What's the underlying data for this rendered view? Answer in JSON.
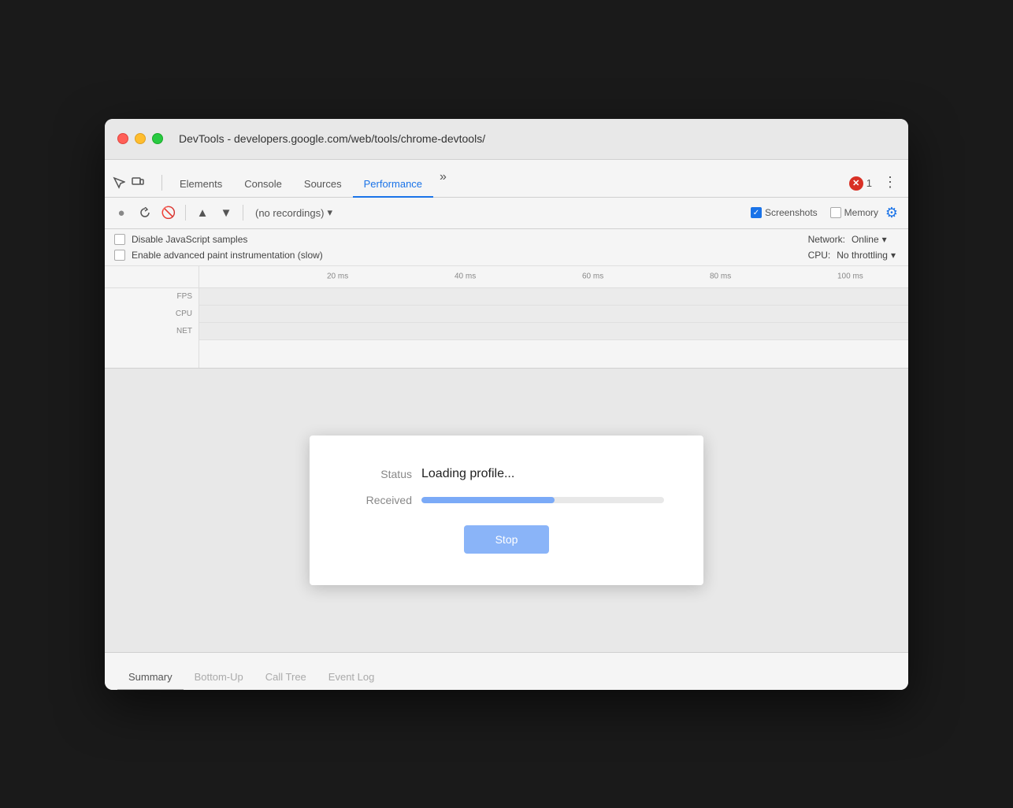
{
  "window": {
    "title": "DevTools - developers.google.com/web/tools/chrome-devtools/"
  },
  "tabs": [
    {
      "id": "elements",
      "label": "Elements",
      "active": false
    },
    {
      "id": "console",
      "label": "Console",
      "active": false
    },
    {
      "id": "sources",
      "label": "Sources",
      "active": false
    },
    {
      "id": "performance",
      "label": "Performance",
      "active": true
    }
  ],
  "toolbar": {
    "recording_label": "(no recordings)",
    "screenshots_label": "Screenshots",
    "memory_label": "Memory",
    "error_count": "1"
  },
  "settings": {
    "disable_js_samples_label": "Disable JavaScript samples",
    "enable_paint_label": "Enable advanced paint instrumentation (slow)",
    "network_label": "Network:",
    "network_value": "Online",
    "cpu_label": "CPU:",
    "cpu_value": "No throttling"
  },
  "timeline": {
    "ticks": [
      "20 ms",
      "40 ms",
      "60 ms",
      "80 ms",
      "100 ms"
    ],
    "tracks": [
      {
        "label": "FPS"
      },
      {
        "label": "CPU"
      },
      {
        "label": "NET"
      }
    ]
  },
  "dialog": {
    "status_label": "Status",
    "status_value": "Loading profile...",
    "received_label": "Received",
    "progress_percent": 55,
    "stop_button_label": "Stop"
  },
  "bottom_tabs": [
    {
      "id": "summary",
      "label": "Summary",
      "active": true
    },
    {
      "id": "bottom-up",
      "label": "Bottom-Up",
      "active": false
    },
    {
      "id": "call-tree",
      "label": "Call Tree",
      "active": false
    },
    {
      "id": "event-log",
      "label": "Event Log",
      "active": false
    }
  ]
}
